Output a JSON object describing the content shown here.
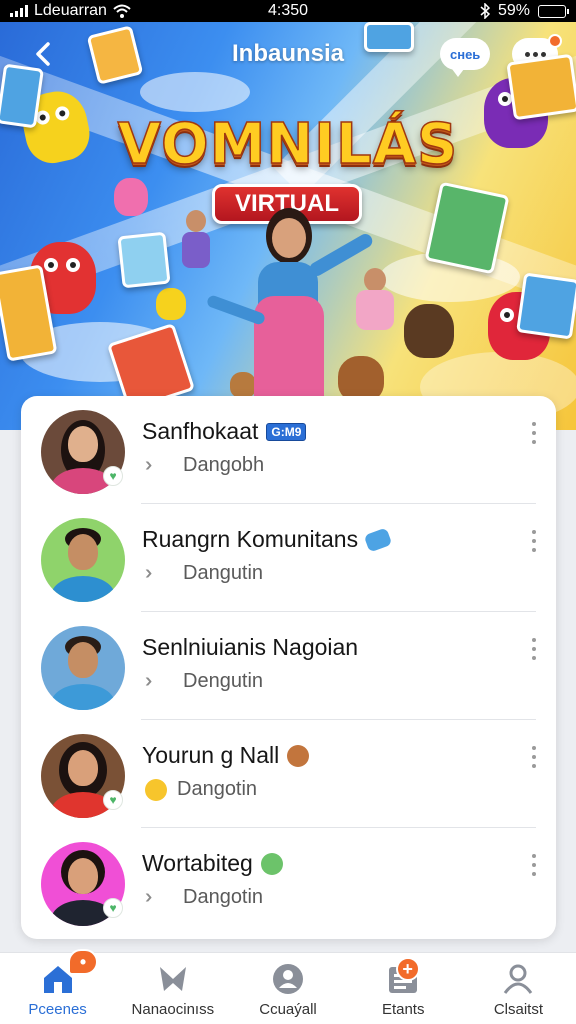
{
  "status_bar": {
    "carrier": "Ldeuarran",
    "time": "4:350",
    "battery": "59%",
    "battery_level": 0.59
  },
  "header": {
    "title": "Inbaunsia",
    "chat_bubble": "cнeь"
  },
  "hero": {
    "logo_main": "VOMNILÁS",
    "logo_sub": "VIRTUAL"
  },
  "list": [
    {
      "name": "Sanfhokaat",
      "badge": "G:M9",
      "subtitle": "Dangobh"
    },
    {
      "name": "Ruangrn Komunitans",
      "subtitle": "Dangutin"
    },
    {
      "name": "Senlniuianis Nagoian",
      "subtitle": "Dengutin"
    },
    {
      "name": "Yourun g Nall",
      "subtitle": "Dangotin"
    },
    {
      "name": "Wortabiteg",
      "subtitle": "Dangotin"
    }
  ],
  "bottom_nav": [
    {
      "label": "Pceenes",
      "icon": "home-icon",
      "active": true
    },
    {
      "label": "Nanaocinıss",
      "icon": "ribbon-icon"
    },
    {
      "label": "Ccuaýall",
      "icon": "person-circle-icon"
    },
    {
      "label": "Etants",
      "icon": "list-icon"
    },
    {
      "label": "Clsaitst",
      "icon": "user-icon"
    }
  ],
  "colors": {
    "accent": "#2b6fd6",
    "badge_orange": "#f26b2a",
    "verified_green": "#4cb567"
  }
}
